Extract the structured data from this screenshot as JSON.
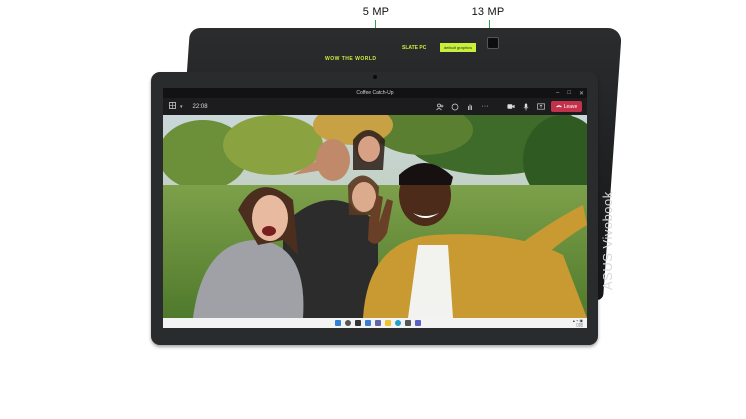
{
  "callouts": {
    "front_camera": "5 MP",
    "rear_camera": "13 MP"
  },
  "device": {
    "lid_text_wow": "WOW THE WORLD",
    "lid_text_slate": "SLATE PC",
    "lid_sticker_text": "default graphics",
    "lid_brand": "ASUS Vivobook"
  },
  "window": {
    "title": "Coffee Catch-Up",
    "controls": [
      "–",
      "□",
      "✕"
    ]
  },
  "toolbar": {
    "meeting_time": "22:08",
    "icons": [
      "people-icon",
      "chat-icon",
      "raise-hand-icon",
      "more-icon",
      "camera-icon",
      "mic-icon",
      "share-icon"
    ],
    "leave_label": "Leave"
  },
  "colors": {
    "accent_lime": "#c8ef3a",
    "callout_green": "#2ca44a",
    "leave_red": "#c4314b"
  },
  "taskbar": {
    "icons": [
      "start-icon",
      "search-icon",
      "task-view-icon",
      "widgets-icon",
      "chat-icon",
      "explorer-icon",
      "edge-icon",
      "store-icon",
      "teams-icon"
    ]
  }
}
